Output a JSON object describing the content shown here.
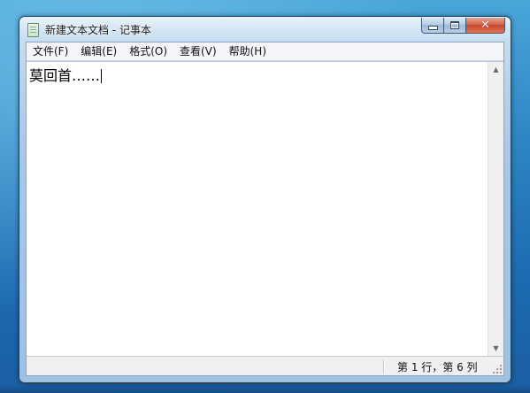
{
  "window": {
    "title": "新建文本文档 - 记事本"
  },
  "menu": {
    "items": [
      "文件(F)",
      "编辑(E)",
      "格式(O)",
      "查看(V)",
      "帮助(H)"
    ]
  },
  "editor": {
    "content": "莫回首……"
  },
  "status": {
    "position": "第 1 行，第 6 列"
  },
  "icons": {
    "app": "notepad-icon",
    "minimize": "minimize-icon",
    "maximize": "maximize-icon",
    "close": "close-icon",
    "scroll_up": "arrow-up-icon",
    "scroll_down": "arrow-down-icon",
    "grip": "resize-grip-icon"
  },
  "colors": {
    "close_button": "#c4452a",
    "window_frame": "#a7c7e6",
    "desktop": "#2f86c4"
  }
}
